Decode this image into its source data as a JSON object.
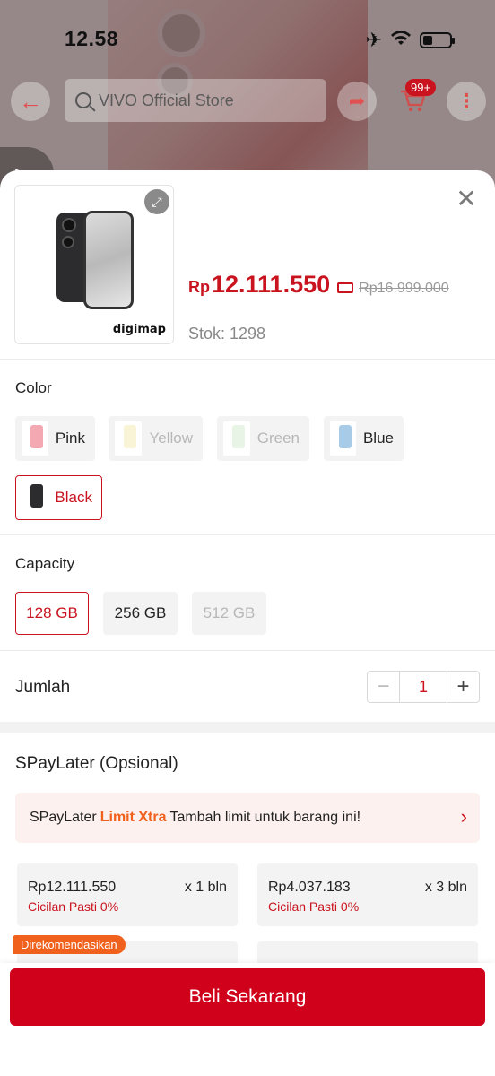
{
  "status_bar": {
    "time": "12.58"
  },
  "topbar": {
    "search_placeholder": "VIVO Official Store",
    "cart_badge": "99+"
  },
  "product": {
    "brand_logo": "digimap",
    "price_prefix": "Rp",
    "price": "12.111.550",
    "original_price": "Rp16.999.000",
    "stock": "Stok: 1298"
  },
  "color": {
    "label": "Color",
    "options": [
      {
        "label": "Pink",
        "state": "enabled",
        "swatch": "#f4a9b2"
      },
      {
        "label": "Yellow",
        "state": "disabled",
        "swatch": "#f3e7a6"
      },
      {
        "label": "Green",
        "state": "disabled",
        "swatch": "#cde6c5"
      },
      {
        "label": "Blue",
        "state": "enabled",
        "swatch": "#a8cbe8"
      },
      {
        "label": "Black",
        "state": "selected",
        "swatch": "#2c2c2e"
      }
    ]
  },
  "capacity": {
    "label": "Capacity",
    "options": [
      {
        "label": "128 GB",
        "state": "selected"
      },
      {
        "label": "256 GB",
        "state": "enabled"
      },
      {
        "label": "512 GB",
        "state": "disabled"
      }
    ]
  },
  "quantity": {
    "label": "Jumlah",
    "value": "1"
  },
  "spaylater": {
    "title": "SPayLater (Opsional)",
    "banner_brand": "SPayLater",
    "banner_xtra": "Limit Xtra",
    "banner_text": "Tambah limit untuk barang ini!",
    "plans": [
      {
        "amount": "Rp12.111.550",
        "term": "x 1 bln",
        "note": "Cicilan Pasti 0%"
      },
      {
        "amount": "Rp4.037.183",
        "term": "x 3 bln",
        "note": "Cicilan Pasti 0%"
      }
    ],
    "recommended_badge": "Direkomendasikan"
  },
  "cta": {
    "buy_label": "Beli Sekarang"
  },
  "colors": {
    "accent": "#c9131e",
    "cta": "#d0011b",
    "orange": "#f0611d"
  }
}
